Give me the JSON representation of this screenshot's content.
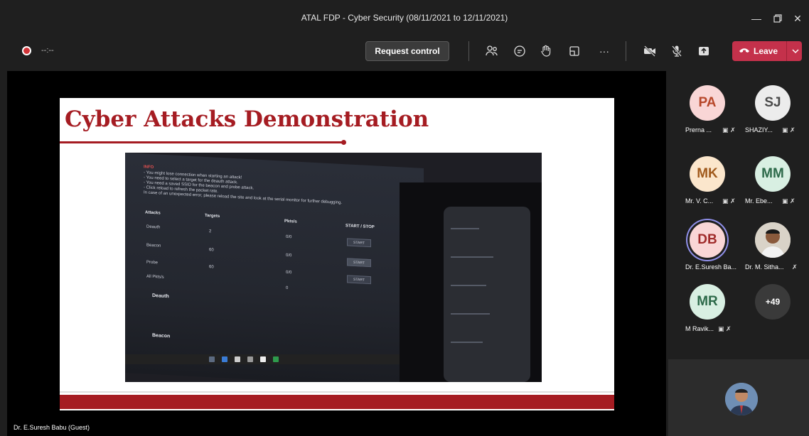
{
  "window": {
    "title": "ATAL FDP - Cyber Security (08/11/2021 to 12/11/2021)"
  },
  "toolbar": {
    "timer": "--:--",
    "request_control": "Request control",
    "more": "···",
    "leave": "Leave"
  },
  "slide": {
    "title": "Cyber Attacks Demonstration",
    "screen_text": {
      "info": "INFO",
      "lines": [
        "- You might lose connection when starting an attack!",
        "- You need to select a target for the deauth attack.",
        "- You need a saved SSID for the beacon and probe attack.",
        "- Click reload to refresh the packet rate.",
        "In case of an unexpected error, please reload the site and look at the serial monitor for further debugging."
      ],
      "headers": [
        "Attacks",
        "Targets",
        "Pkts/s",
        "START / STOP"
      ],
      "rows": [
        {
          "name": "Deauth",
          "targets": "2",
          "pkts": "0/0",
          "btn": "START"
        },
        {
          "name": "Beacon",
          "targets": "60",
          "pkts": "0/0",
          "btn": "START"
        },
        {
          "name": "Probe",
          "targets": "60",
          "pkts": "0/0",
          "btn": "START"
        },
        {
          "name": "All Pkts/s",
          "targets": "",
          "pkts": "0",
          "btn": ""
        }
      ],
      "section1": "Deauth",
      "section2": "Beacon"
    }
  },
  "presenter": {
    "name": "Dr. E.Suresh Babu (Guest)"
  },
  "participants": [
    {
      "initials": "PA",
      "name": "Prerna ...",
      "bg": "#f9d6d6",
      "fg": "#b7472a",
      "ring": false
    },
    {
      "initials": "SJ",
      "name": "SHAZIY...",
      "bg": "#ececec",
      "fg": "#4a4a4a",
      "ring": false
    },
    {
      "initials": "MK",
      "name": "Mr. V. C...",
      "bg": "#fbe6cc",
      "fg": "#a05a1c",
      "ring": false
    },
    {
      "initials": "MM",
      "name": "Mr. Ebe...",
      "bg": "#d8efe2",
      "fg": "#2d6a4a",
      "ring": false
    },
    {
      "initials": "DB",
      "name": "Dr. E.Suresh Ba...",
      "bg": "#f9d6d6",
      "fg": "#a02b2b",
      "ring": true
    },
    {
      "initials": "",
      "name": "Dr. M. Sitha...",
      "bg": "#c9c4bb",
      "fg": "#333",
      "ring": false
    },
    {
      "initials": "MR",
      "name": "M Ravik...",
      "bg": "#d8efe2",
      "fg": "#2d6a4a",
      "ring": false
    },
    {
      "initials": "+49",
      "name": "",
      "bg": "#3a3a3a",
      "fg": "#ffffff",
      "ring": false
    }
  ],
  "colors": {
    "accent": "#c4314b",
    "slide_red": "#a51c22",
    "ring": "#8f8fe8"
  },
  "icons": [
    "record-icon",
    "people-icon",
    "chat-icon",
    "raise-hand-icon",
    "rooms-icon",
    "more-icon",
    "camera-off-icon",
    "mic-off-icon",
    "share-icon",
    "phone-icon",
    "chevron-down-icon",
    "minimize-icon",
    "restore-icon",
    "close-icon"
  ]
}
